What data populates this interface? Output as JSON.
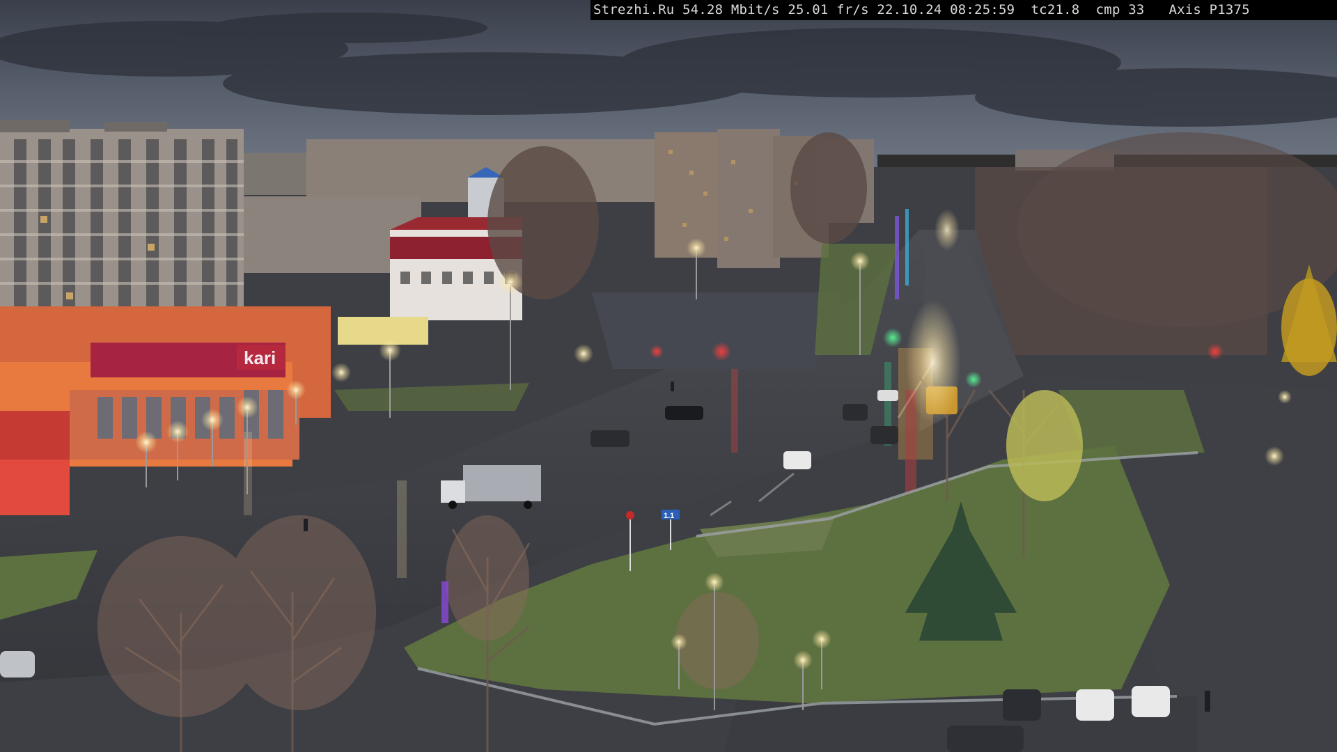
{
  "overlay": {
    "site": "Strezhi.Ru",
    "bitrate": "54.28 Mbit/s",
    "framerate": "25.01 fr/s",
    "date": "22.10.24",
    "time": "08:25:59",
    "tc": "tc21.8",
    "cmp": "cmp 33",
    "camera": "Axis P1375"
  },
  "signs": {
    "shop_logo": "kari",
    "road_sign": "1.1"
  }
}
